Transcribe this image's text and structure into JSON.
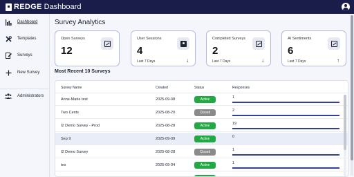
{
  "app": {
    "brand": "REDGE",
    "title": "Dashboard"
  },
  "sidebar": {
    "items": [
      {
        "label": "Dashboard",
        "icon": "bar-chart-icon",
        "active": true
      },
      {
        "label": "Templates",
        "icon": "tools-icon"
      },
      {
        "label": "Surveys",
        "icon": "survey-icon"
      },
      {
        "label": "New Survey",
        "icon": "plus-icon"
      },
      {
        "label": "Administrators",
        "icon": "group-icon"
      }
    ]
  },
  "main": {
    "title": "Survey Analytics",
    "cards": [
      {
        "title": "Open Surveys",
        "value": "12",
        "footer": "",
        "icon": "external-link-icon",
        "arrow": ""
      },
      {
        "title": "User Sessions",
        "value": "4",
        "footer": "Last 7 Days",
        "icon": "person-badge-icon",
        "arrow": "↓"
      },
      {
        "title": "Completed Surveys",
        "value": "2",
        "footer": "Last 7 Days",
        "icon": "external-link-icon",
        "arrow": "↓"
      },
      {
        "title": "AI Sentiments",
        "value": "6",
        "footer": "Last 7 Days",
        "icon": "external-link-icon",
        "arrow": "↑"
      }
    ],
    "recent_title": "Most Recent 10 Surveys",
    "table": {
      "columns": [
        "Survey Name",
        "Created",
        "Status",
        "Responses"
      ],
      "rows": [
        {
          "name": "Anne-Marie test",
          "created": "2025-09-08",
          "status": "Active",
          "responses": "1",
          "bar_fraction": 1.0
        },
        {
          "name": "Two Cents",
          "created": "2025-08-20",
          "status": "Closed",
          "responses": "2",
          "bar_fraction": 1.0
        },
        {
          "name": "I2 Demo Survey - Prod",
          "created": "2025-08-28",
          "status": "Active",
          "responses": "19",
          "bar_fraction": 1.0
        },
        {
          "name": "Sep 9",
          "created": "2025-09-09",
          "status": "Active",
          "responses": "0",
          "bar_fraction": 0.0
        },
        {
          "name": "I2 Demo Survey",
          "created": "2025-08-28",
          "status": "Closed",
          "responses": "1",
          "bar_fraction": 1.0
        },
        {
          "name": "tes",
          "created": "2025-09-04",
          "status": "Active",
          "responses": "1",
          "bar_fraction": 1.0
        },
        {
          "name": "",
          "created": "2025-09-...",
          "status": "Active",
          "responses": "",
          "bar_fraction": 0.0
        }
      ]
    }
  },
  "colors": {
    "topbar": "#1a1d4a",
    "active": "#22a944",
    "closed": "#8a8a8a",
    "bar": "#2f3f9e",
    "card_border": "#b3badf"
  }
}
